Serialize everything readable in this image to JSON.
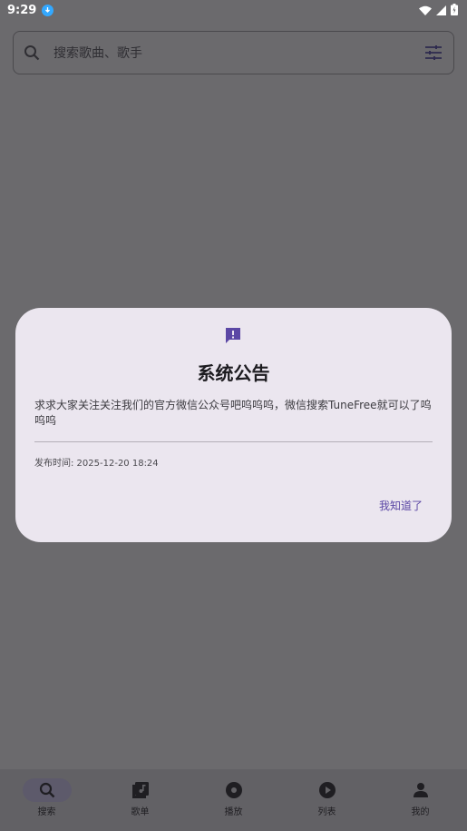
{
  "status": {
    "time": "9:29"
  },
  "search": {
    "placeholder": "搜索歌曲、歌手"
  },
  "dialog": {
    "title": "系统公告",
    "message": "求求大家关注关注我们的官方微信公众号吧呜呜呜，微信搜索TuneFree就可以了呜呜呜",
    "publish_time": "发布时间: 2025-12-20 18:24",
    "confirm_label": "我知道了"
  },
  "nav": {
    "items": [
      {
        "label": "搜索",
        "icon": "search-icon",
        "active": true
      },
      {
        "label": "歌单",
        "icon": "playlist-icon"
      },
      {
        "label": "播放",
        "icon": "disc-icon"
      },
      {
        "label": "列表",
        "icon": "play-circle-icon"
      },
      {
        "label": "我的",
        "icon": "person-icon"
      }
    ]
  },
  "colors": {
    "accent": "#5b47a5",
    "dialog_bg": "#ebe6ef",
    "scrim": "#6b6a6d"
  }
}
